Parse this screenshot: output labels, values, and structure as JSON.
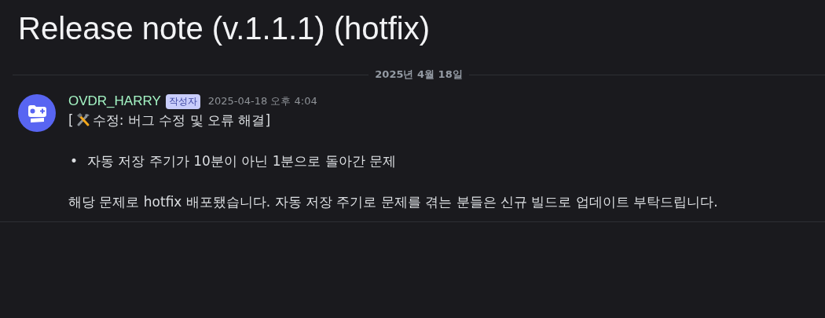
{
  "thread": {
    "title": "Release note (v.1.1.1) (hotfix)"
  },
  "date_divider": "2025년 4월 18일",
  "message": {
    "author": "OVDR_HARRY",
    "badge": "작성자",
    "timestamp": "2025-04-18 오후 4:04",
    "heading_open": "[",
    "heading": "수정: 버그 수정 및 오류 해결]",
    "bullets": [
      {
        "marker": "•",
        "text": "자동 저장 주기가 10분이 아닌 1분으로 돌아간 문제"
      }
    ],
    "paragraph": "해당 문제로 hotfix 배포됐습니다. 자동 저장 주기로 문제를 겪는 분들은 신규 빌드로 업데이트 부탁드립니다."
  }
}
